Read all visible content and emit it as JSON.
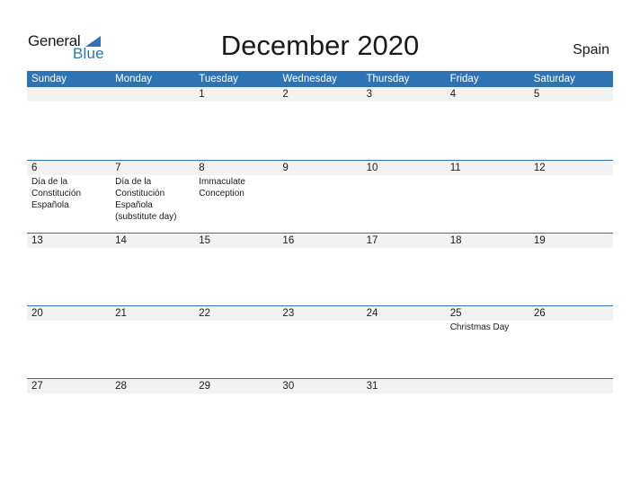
{
  "logo": {
    "general": "General",
    "blue": "Blue",
    "accent_color": "#2e74b5"
  },
  "title": "December 2020",
  "country": "Spain",
  "weekdays": [
    "Sunday",
    "Monday",
    "Tuesday",
    "Wednesday",
    "Thursday",
    "Friday",
    "Saturday"
  ],
  "weeks": [
    [
      {
        "day": ""
      },
      {
        "day": ""
      },
      {
        "day": "1"
      },
      {
        "day": "2"
      },
      {
        "day": "3"
      },
      {
        "day": "4"
      },
      {
        "day": "5"
      }
    ],
    [
      {
        "day": "6",
        "event": "Día de la Constitución Española"
      },
      {
        "day": "7",
        "event": "Día de la Constitución Española (substitute day)"
      },
      {
        "day": "8",
        "event": "Immaculate Conception"
      },
      {
        "day": "9"
      },
      {
        "day": "10"
      },
      {
        "day": "11"
      },
      {
        "day": "12"
      }
    ],
    [
      {
        "day": "13"
      },
      {
        "day": "14"
      },
      {
        "day": "15"
      },
      {
        "day": "16"
      },
      {
        "day": "17"
      },
      {
        "day": "18"
      },
      {
        "day": "19"
      }
    ],
    [
      {
        "day": "20"
      },
      {
        "day": "21"
      },
      {
        "day": "22"
      },
      {
        "day": "23"
      },
      {
        "day": "24"
      },
      {
        "day": "25",
        "event": "Christmas Day"
      },
      {
        "day": "26"
      }
    ],
    [
      {
        "day": "27"
      },
      {
        "day": "28"
      },
      {
        "day": "29"
      },
      {
        "day": "30"
      },
      {
        "day": "31"
      },
      {
        "day": ""
      },
      {
        "day": ""
      }
    ]
  ]
}
